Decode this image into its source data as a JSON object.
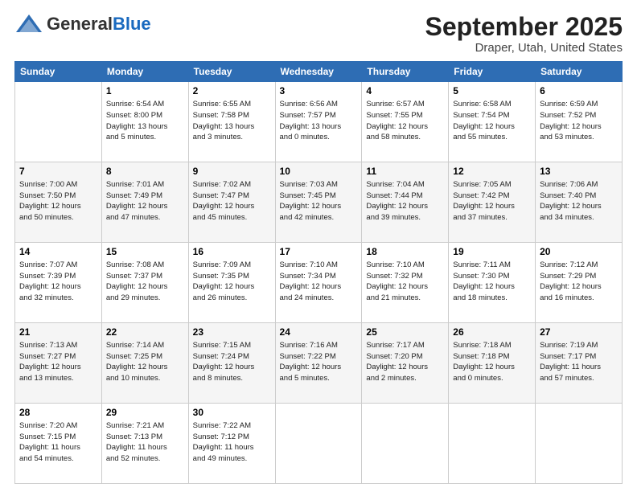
{
  "logo": {
    "general": "General",
    "blue": "Blue"
  },
  "header": {
    "month": "September 2025",
    "location": "Draper, Utah, United States"
  },
  "days_of_week": [
    "Sunday",
    "Monday",
    "Tuesday",
    "Wednesday",
    "Thursday",
    "Friday",
    "Saturday"
  ],
  "weeks": [
    [
      {
        "day": "",
        "info": ""
      },
      {
        "day": "1",
        "info": "Sunrise: 6:54 AM\nSunset: 8:00 PM\nDaylight: 13 hours\nand 5 minutes."
      },
      {
        "day": "2",
        "info": "Sunrise: 6:55 AM\nSunset: 7:58 PM\nDaylight: 13 hours\nand 3 minutes."
      },
      {
        "day": "3",
        "info": "Sunrise: 6:56 AM\nSunset: 7:57 PM\nDaylight: 13 hours\nand 0 minutes."
      },
      {
        "day": "4",
        "info": "Sunrise: 6:57 AM\nSunset: 7:55 PM\nDaylight: 12 hours\nand 58 minutes."
      },
      {
        "day": "5",
        "info": "Sunrise: 6:58 AM\nSunset: 7:54 PM\nDaylight: 12 hours\nand 55 minutes."
      },
      {
        "day": "6",
        "info": "Sunrise: 6:59 AM\nSunset: 7:52 PM\nDaylight: 12 hours\nand 53 minutes."
      }
    ],
    [
      {
        "day": "7",
        "info": "Sunrise: 7:00 AM\nSunset: 7:50 PM\nDaylight: 12 hours\nand 50 minutes."
      },
      {
        "day": "8",
        "info": "Sunrise: 7:01 AM\nSunset: 7:49 PM\nDaylight: 12 hours\nand 47 minutes."
      },
      {
        "day": "9",
        "info": "Sunrise: 7:02 AM\nSunset: 7:47 PM\nDaylight: 12 hours\nand 45 minutes."
      },
      {
        "day": "10",
        "info": "Sunrise: 7:03 AM\nSunset: 7:45 PM\nDaylight: 12 hours\nand 42 minutes."
      },
      {
        "day": "11",
        "info": "Sunrise: 7:04 AM\nSunset: 7:44 PM\nDaylight: 12 hours\nand 39 minutes."
      },
      {
        "day": "12",
        "info": "Sunrise: 7:05 AM\nSunset: 7:42 PM\nDaylight: 12 hours\nand 37 minutes."
      },
      {
        "day": "13",
        "info": "Sunrise: 7:06 AM\nSunset: 7:40 PM\nDaylight: 12 hours\nand 34 minutes."
      }
    ],
    [
      {
        "day": "14",
        "info": "Sunrise: 7:07 AM\nSunset: 7:39 PM\nDaylight: 12 hours\nand 32 minutes."
      },
      {
        "day": "15",
        "info": "Sunrise: 7:08 AM\nSunset: 7:37 PM\nDaylight: 12 hours\nand 29 minutes."
      },
      {
        "day": "16",
        "info": "Sunrise: 7:09 AM\nSunset: 7:35 PM\nDaylight: 12 hours\nand 26 minutes."
      },
      {
        "day": "17",
        "info": "Sunrise: 7:10 AM\nSunset: 7:34 PM\nDaylight: 12 hours\nand 24 minutes."
      },
      {
        "day": "18",
        "info": "Sunrise: 7:10 AM\nSunset: 7:32 PM\nDaylight: 12 hours\nand 21 minutes."
      },
      {
        "day": "19",
        "info": "Sunrise: 7:11 AM\nSunset: 7:30 PM\nDaylight: 12 hours\nand 18 minutes."
      },
      {
        "day": "20",
        "info": "Sunrise: 7:12 AM\nSunset: 7:29 PM\nDaylight: 12 hours\nand 16 minutes."
      }
    ],
    [
      {
        "day": "21",
        "info": "Sunrise: 7:13 AM\nSunset: 7:27 PM\nDaylight: 12 hours\nand 13 minutes."
      },
      {
        "day": "22",
        "info": "Sunrise: 7:14 AM\nSunset: 7:25 PM\nDaylight: 12 hours\nand 10 minutes."
      },
      {
        "day": "23",
        "info": "Sunrise: 7:15 AM\nSunset: 7:24 PM\nDaylight: 12 hours\nand 8 minutes."
      },
      {
        "day": "24",
        "info": "Sunrise: 7:16 AM\nSunset: 7:22 PM\nDaylight: 12 hours\nand 5 minutes."
      },
      {
        "day": "25",
        "info": "Sunrise: 7:17 AM\nSunset: 7:20 PM\nDaylight: 12 hours\nand 2 minutes."
      },
      {
        "day": "26",
        "info": "Sunrise: 7:18 AM\nSunset: 7:18 PM\nDaylight: 12 hours\nand 0 minutes."
      },
      {
        "day": "27",
        "info": "Sunrise: 7:19 AM\nSunset: 7:17 PM\nDaylight: 11 hours\nand 57 minutes."
      }
    ],
    [
      {
        "day": "28",
        "info": "Sunrise: 7:20 AM\nSunset: 7:15 PM\nDaylight: 11 hours\nand 54 minutes."
      },
      {
        "day": "29",
        "info": "Sunrise: 7:21 AM\nSunset: 7:13 PM\nDaylight: 11 hours\nand 52 minutes."
      },
      {
        "day": "30",
        "info": "Sunrise: 7:22 AM\nSunset: 7:12 PM\nDaylight: 11 hours\nand 49 minutes."
      },
      {
        "day": "",
        "info": ""
      },
      {
        "day": "",
        "info": ""
      },
      {
        "day": "",
        "info": ""
      },
      {
        "day": "",
        "info": ""
      }
    ]
  ]
}
